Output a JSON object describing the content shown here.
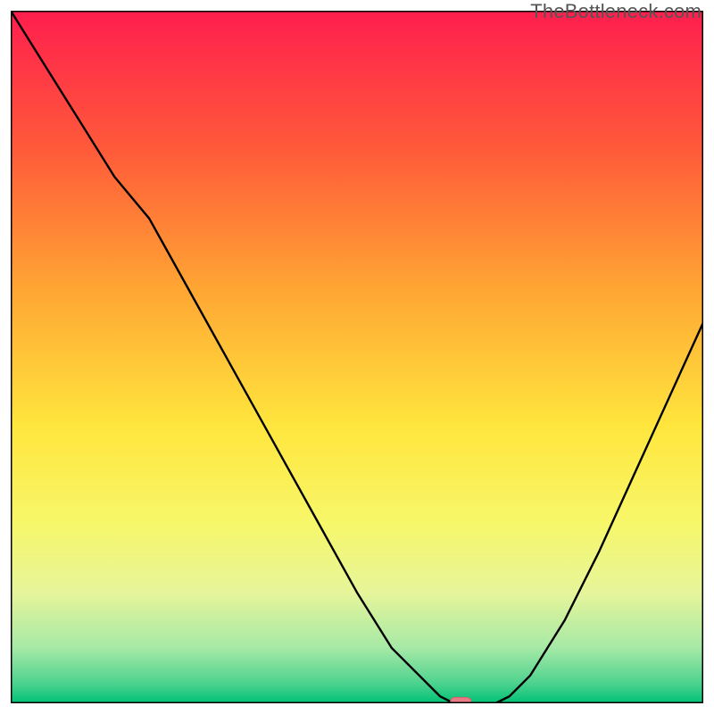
{
  "watermark": "TheBottleneck.com",
  "chart_data": {
    "type": "line",
    "title": "",
    "xlabel": "",
    "ylabel": "",
    "xlim": [
      0,
      100
    ],
    "ylim": [
      0,
      100
    ],
    "x": [
      0,
      5,
      10,
      15,
      20,
      25,
      30,
      35,
      40,
      45,
      50,
      55,
      60,
      62,
      64,
      66,
      68,
      70,
      72,
      75,
      80,
      85,
      90,
      95,
      100
    ],
    "values": [
      100,
      92,
      84,
      76,
      70,
      61,
      52,
      43,
      34,
      25,
      16,
      8,
      3,
      1,
      0,
      0,
      0,
      0,
      1,
      4,
      12,
      22,
      33,
      44,
      55
    ],
    "gradient_stops": [
      {
        "offset": 0.0,
        "color": "#ff1e4e"
      },
      {
        "offset": 0.2,
        "color": "#ff5a3a"
      },
      {
        "offset": 0.4,
        "color": "#ffa533"
      },
      {
        "offset": 0.6,
        "color": "#ffe63d"
      },
      {
        "offset": 0.74,
        "color": "#f7f76a"
      },
      {
        "offset": 0.84,
        "color": "#e6f59a"
      },
      {
        "offset": 0.92,
        "color": "#a6e9a6"
      },
      {
        "offset": 0.97,
        "color": "#4fd38f"
      },
      {
        "offset": 1.0,
        "color": "#00c176"
      }
    ],
    "marker": {
      "x": 65,
      "y": 0,
      "width_rel": 3.0,
      "height_rel": 1.2,
      "fill": "#e97b87",
      "stroke": "#d85f6e"
    },
    "line_stroke": "#000000",
    "line_width": 2.4,
    "border_stroke": "#000000",
    "border_width": 3
  }
}
